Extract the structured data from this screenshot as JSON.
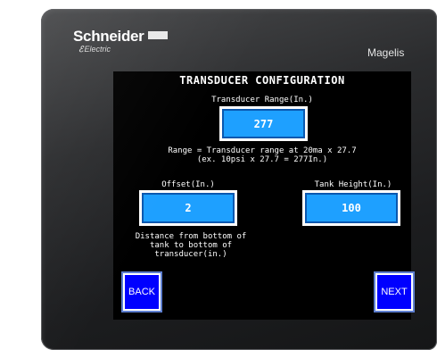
{
  "device": {
    "brand_logo_text": "Schneider",
    "brand_logo_sub": "Electric",
    "model_label": "Magelis"
  },
  "screen": {
    "title": "TRANSDUCER CONFIGURATION",
    "transducer_range": {
      "label": "Transducer Range(In.)",
      "value": "277"
    },
    "range_note_line1": "Range = Transducer range at 20ma x 27.7",
    "range_note_line2": "(ex. 10psi x 27.7 = 277In.)",
    "offset": {
      "label": "Offset(In.)",
      "value": "2",
      "note": "Distance from bottom of\ntank to bottom of\ntransducer(in.)"
    },
    "tank_height": {
      "label": "Tank Height(In.)",
      "value": "100"
    },
    "buttons": {
      "back_label": "BACK",
      "next_label": "NEXT"
    }
  },
  "colors": {
    "field_fill": "#1ea0ff",
    "nav_button_fill": "#0000ff",
    "screen_background": "#000000"
  }
}
